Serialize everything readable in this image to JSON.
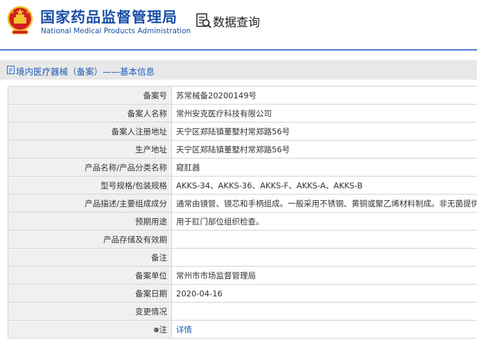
{
  "header": {
    "title_cn": "国家药品监督管理局",
    "title_en": "National Medical Products Administration",
    "query_label": "数据查询"
  },
  "breadcrumb": {
    "text": "境内医疗器械（备案）——基本信息"
  },
  "rows": [
    {
      "label": "备案号",
      "value": "苏常械备20200149号"
    },
    {
      "label": "备案人名称",
      "value": "常州安克医疗科技有限公司"
    },
    {
      "label": "备案人注册地址",
      "value": "天宁区郑陆镇董墅村常郑路56号"
    },
    {
      "label": "生产地址",
      "value": "天宁区郑陆镇董墅村常郑路56号"
    },
    {
      "label": "产品名称/产品分类名称",
      "value": "窥肛器"
    },
    {
      "label": "型号规格/包装规格",
      "value": "AKKS-34、AKKS-36、AKKS-F、AKKS-A、AKKS-B"
    },
    {
      "label": "产品描述/主要组成成分",
      "value": "通常由镜管、镜芯和手柄组成。一般采用不锈钢、黄铜或聚乙烯材料制成。非无菌提供。"
    },
    {
      "label": "预期用途",
      "value": "用于肛门部位组织检查。"
    },
    {
      "label": "产品存储及有效期",
      "value": ""
    },
    {
      "label": "备注",
      "value": ""
    },
    {
      "label": "备案单位",
      "value": "常州市市场监督管理局"
    },
    {
      "label": "备案日期",
      "value": "2020-04-16"
    },
    {
      "label": "变更情况",
      "value": ""
    }
  ],
  "note_row": {
    "label": "注",
    "link": "详情"
  },
  "colors": {
    "brand_blue": "#1a4fa8",
    "link_blue": "#1d5cb5",
    "emblem_red": "#d3201f",
    "emblem_gold": "#f2c230"
  }
}
